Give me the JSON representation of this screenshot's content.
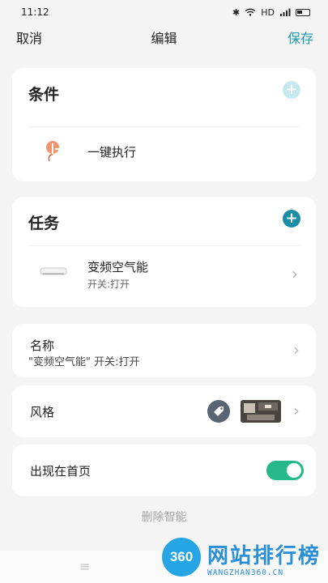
{
  "status": {
    "time": "11:12",
    "network": "HD",
    "signal": "4G"
  },
  "nav": {
    "cancel": "取消",
    "title": "编辑",
    "save": "保存"
  },
  "condition": {
    "title": "条件",
    "item_label": "一键执行",
    "add_icon": "plus-icon"
  },
  "task": {
    "title": "任务",
    "add_icon": "plus-icon",
    "item_name": "变频空气能",
    "item_detail": "开关:打开"
  },
  "name_row": {
    "label": "名称",
    "value": "\"变频空气能\" 开关:打开"
  },
  "style_row": {
    "label": "风格"
  },
  "home_row": {
    "label": "出现在首页",
    "enabled": true
  },
  "delete_label": "删除智能",
  "watermark": {
    "logo": "360",
    "name": "网站排行榜",
    "url": "WANGZHAN360.CN"
  },
  "colors": {
    "accent": "#1f9bb0",
    "toggle_on": "#27b889",
    "plus_dark": "#1a8ea6"
  }
}
